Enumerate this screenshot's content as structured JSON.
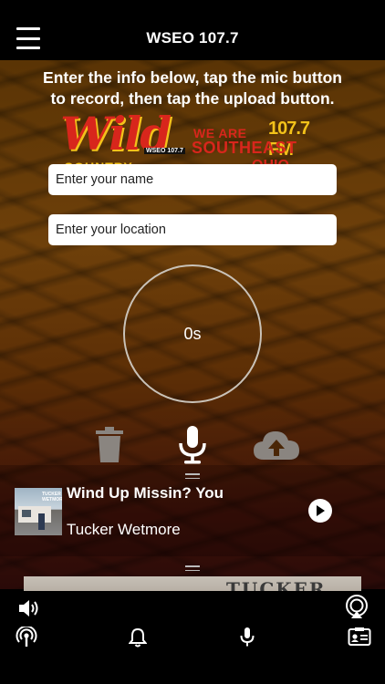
{
  "header": {
    "title": "WSEO 107.7"
  },
  "logo": {
    "wild": "Wild",
    "station_small": "WSEO 107.7",
    "country": "COUNTRY",
    "we_are": "WE ARE",
    "frequency": "107.7 FM",
    "southeast": "SOUTHEAST",
    "ohio": "OHIO"
  },
  "recorder": {
    "instructions": "Enter the info below, tap the mic button to record, then tap the upload button.",
    "name_placeholder": "Enter your name",
    "location_placeholder": "Enter your location",
    "timer": "0s"
  },
  "now_playing": {
    "title": "Wind Up Missin? You",
    "artist": "Tucker Wetmore",
    "album_text": "TUCKER WETMORE",
    "banner_text": "TUCKER"
  },
  "bottom_bar": {
    "icons": [
      "volume-icon",
      "airplay-icon",
      "podcast-icon",
      "bell-icon",
      "microphone-icon",
      "contact-card-icon"
    ]
  },
  "colors": {
    "header_bg": "#000000",
    "background_top": "#6e400a",
    "background_bottom": "#2a0a08",
    "field_bg": "#ffffff",
    "circle_border": "#c9c2b8"
  }
}
